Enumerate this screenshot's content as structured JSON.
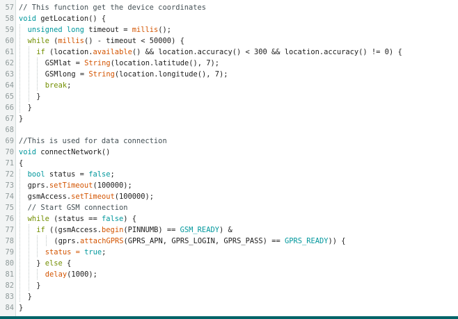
{
  "editor": {
    "colors": {
      "comment": "#434f54",
      "type": "#00979c",
      "keyword": "#728e00",
      "function": "#d35400",
      "constant": "#00979c",
      "text": "#1c1c1c",
      "line_number": "#8f9a9a",
      "status_bar": "#006468"
    },
    "lines": [
      {
        "num": "57",
        "indent": 0,
        "tokens": [
          {
            "t": "// This function get the device coordinates",
            "k": "comment"
          }
        ]
      },
      {
        "num": "58",
        "indent": 0,
        "tokens": [
          {
            "t": "void ",
            "k": "type"
          },
          {
            "t": "getLocation",
            "k": "plain"
          },
          {
            "t": "() {",
            "k": "plain"
          }
        ]
      },
      {
        "num": "59",
        "indent": 1,
        "tokens": [
          {
            "t": "unsigned long ",
            "k": "type"
          },
          {
            "t": "timeout = ",
            "k": "plain"
          },
          {
            "t": "millis",
            "k": "func"
          },
          {
            "t": "();",
            "k": "plain"
          }
        ]
      },
      {
        "num": "60",
        "indent": 1,
        "tokens": [
          {
            "t": "while ",
            "k": "keyword"
          },
          {
            "t": "(",
            "k": "plain"
          },
          {
            "t": "millis",
            "k": "func"
          },
          {
            "t": "() - timeout < 50000) {",
            "k": "plain"
          }
        ]
      },
      {
        "num": "61",
        "indent": 2,
        "tokens": [
          {
            "t": "if ",
            "k": "keyword"
          },
          {
            "t": "(location.",
            "k": "plain"
          },
          {
            "t": "available",
            "k": "func"
          },
          {
            "t": "() && location.accuracy() < 300 && location.accuracy() != 0) {",
            "k": "plain"
          }
        ]
      },
      {
        "num": "62",
        "indent": 3,
        "tokens": [
          {
            "t": "GSMlat = ",
            "k": "plain"
          },
          {
            "t": "String",
            "k": "func"
          },
          {
            "t": "(location.latitude(), 7);",
            "k": "plain"
          }
        ]
      },
      {
        "num": "63",
        "indent": 3,
        "tokens": [
          {
            "t": "GSMlong = ",
            "k": "plain"
          },
          {
            "t": "String",
            "k": "func"
          },
          {
            "t": "(location.longitude(), 7);",
            "k": "plain"
          }
        ]
      },
      {
        "num": "64",
        "indent": 3,
        "tokens": [
          {
            "t": "break",
            "k": "keyword"
          },
          {
            "t": ";",
            "k": "plain"
          }
        ]
      },
      {
        "num": "65",
        "indent": 2,
        "tokens": [
          {
            "t": "}",
            "k": "plain"
          }
        ]
      },
      {
        "num": "66",
        "indent": 1,
        "tokens": [
          {
            "t": "}",
            "k": "plain"
          }
        ]
      },
      {
        "num": "67",
        "indent": 0,
        "tokens": [
          {
            "t": "}",
            "k": "plain"
          }
        ]
      },
      {
        "num": "68",
        "indent": 0,
        "tokens": []
      },
      {
        "num": "69",
        "indent": 0,
        "tokens": [
          {
            "t": "//This is used for data connection",
            "k": "comment"
          }
        ]
      },
      {
        "num": "70",
        "indent": 0,
        "tokens": [
          {
            "t": "void ",
            "k": "type"
          },
          {
            "t": "connectNetwork",
            "k": "plain"
          },
          {
            "t": "()",
            "k": "plain"
          }
        ]
      },
      {
        "num": "71",
        "indent": 0,
        "tokens": [
          {
            "t": "{",
            "k": "plain"
          }
        ]
      },
      {
        "num": "72",
        "indent": 1,
        "tokens": [
          {
            "t": "bool ",
            "k": "type"
          },
          {
            "t": "status = ",
            "k": "plain"
          },
          {
            "t": "false",
            "k": "const"
          },
          {
            "t": ";",
            "k": "plain"
          }
        ]
      },
      {
        "num": "73",
        "indent": 1,
        "tokens": [
          {
            "t": "gprs.",
            "k": "plain"
          },
          {
            "t": "setTimeout",
            "k": "func"
          },
          {
            "t": "(100000);",
            "k": "plain"
          }
        ]
      },
      {
        "num": "74",
        "indent": 1,
        "tokens": [
          {
            "t": "gsmAccess.",
            "k": "plain"
          },
          {
            "t": "setTimeout",
            "k": "func"
          },
          {
            "t": "(100000);",
            "k": "plain"
          }
        ]
      },
      {
        "num": "75",
        "indent": 1,
        "tokens": [
          {
            "t": "// Start GSM connection",
            "k": "comment"
          }
        ]
      },
      {
        "num": "76",
        "indent": 1,
        "tokens": [
          {
            "t": "while ",
            "k": "keyword"
          },
          {
            "t": "(status == ",
            "k": "plain"
          },
          {
            "t": "false",
            "k": "const"
          },
          {
            "t": ") {",
            "k": "plain"
          }
        ]
      },
      {
        "num": "77",
        "indent": 2,
        "tokens": [
          {
            "t": "if ",
            "k": "keyword"
          },
          {
            "t": "((gsmAccess.",
            "k": "plain"
          },
          {
            "t": "begin",
            "k": "func"
          },
          {
            "t": "(PINNUMB) == ",
            "k": "plain"
          },
          {
            "t": "GSM_READY",
            "k": "const"
          },
          {
            "t": ") &",
            "k": "plain"
          }
        ]
      },
      {
        "num": "78",
        "indent": 4,
        "tokens": [
          {
            "t": "(gprs.",
            "k": "plain"
          },
          {
            "t": "attachGPRS",
            "k": "func"
          },
          {
            "t": "(GPRS_APN, GPRS_LOGIN, GPRS_PASS) == ",
            "k": "plain"
          },
          {
            "t": "GPRS_READY",
            "k": "const"
          },
          {
            "t": ")) {",
            "k": "plain"
          }
        ]
      },
      {
        "num": "79",
        "indent": 3,
        "tokens": [
          {
            "t": "status = ",
            "k": "func"
          },
          {
            "t": "true",
            "k": "const"
          },
          {
            "t": ";",
            "k": "plain"
          }
        ]
      },
      {
        "num": "80",
        "indent": 2,
        "tokens": [
          {
            "t": "} ",
            "k": "plain"
          },
          {
            "t": "else ",
            "k": "keyword"
          },
          {
            "t": "{",
            "k": "plain"
          }
        ]
      },
      {
        "num": "81",
        "indent": 3,
        "tokens": [
          {
            "t": "delay",
            "k": "func"
          },
          {
            "t": "(1000);",
            "k": "plain"
          }
        ]
      },
      {
        "num": "82",
        "indent": 2,
        "tokens": [
          {
            "t": "}",
            "k": "plain"
          }
        ]
      },
      {
        "num": "83",
        "indent": 1,
        "tokens": [
          {
            "t": "}",
            "k": "plain"
          }
        ]
      },
      {
        "num": "84",
        "indent": 0,
        "tokens": [
          {
            "t": "}",
            "k": "plain"
          }
        ]
      }
    ]
  }
}
